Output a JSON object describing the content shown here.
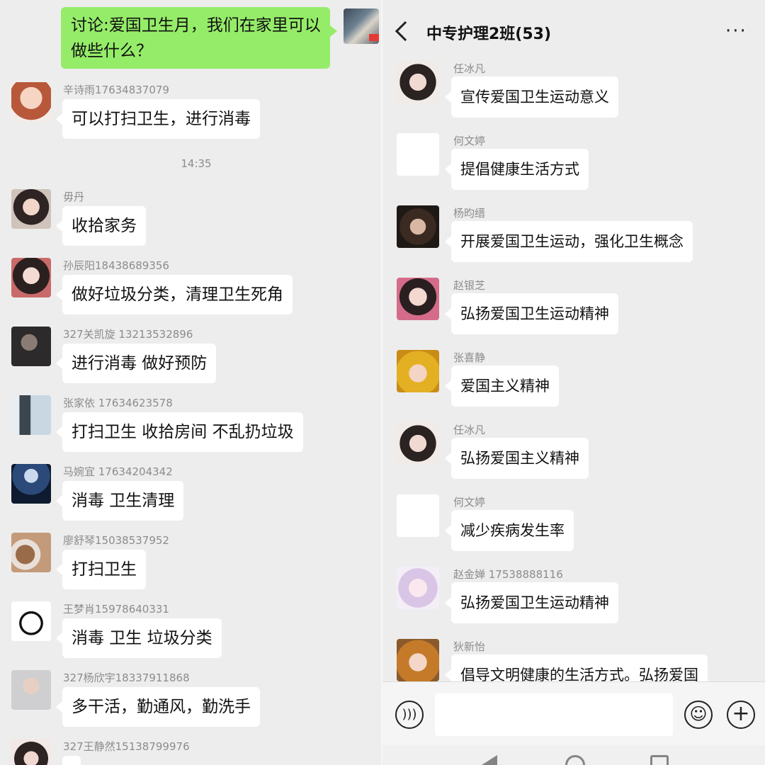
{
  "left": {
    "top_message": "讨论:爱国卫生月，我们在家里可以做些什么？",
    "timestamp": "14:35",
    "messages": [
      {
        "name": "辛诗雨17634837079",
        "text": "可以打扫卫生，进行消毒"
      },
      {
        "name": "毋丹",
        "text": "收拾家务"
      },
      {
        "name": "孙辰阳18438689356",
        "text": "做好垃圾分类，清理卫生死角"
      },
      {
        "name": "327关凯旋  13213532896",
        "text": "进行消毒  做好预防"
      },
      {
        "name": "张家依 17634623578",
        "text": "打扫卫生   收拾房间   不乱扔垃圾"
      },
      {
        "name": "马婉宜  17634204342",
        "text": "消毒   卫生清理"
      },
      {
        "name": "廖舒琴15038537952",
        "text": "打扫卫生"
      },
      {
        "name": "王梦肖15978640331",
        "text": "消毒 卫生 垃圾分类"
      },
      {
        "name": "327杨欣宇18337911868",
        "text": "多干活，勤通风，勤洗手"
      },
      {
        "name": "327王静然15138799976",
        "text": ""
      }
    ]
  },
  "right": {
    "header": {
      "title": "中专护理2班(53)",
      "more": "···"
    },
    "messages": [
      {
        "name": "任冰凡",
        "text": "宣传爱国卫生运动意义"
      },
      {
        "name": "何文婷",
        "text": "提倡健康生活方式"
      },
      {
        "name": "杨昀缙",
        "text": "开展爱国卫生运动，强化卫生概念"
      },
      {
        "name": "赵银芝",
        "text": "弘扬爱国卫生运动精神"
      },
      {
        "name": "张喜静",
        "text": "爱国主义精神"
      },
      {
        "name": "任冰凡",
        "text": "弘扬爱国主义精神"
      },
      {
        "name": "何文婷",
        "text": "减少疾病发生率"
      },
      {
        "name": "赵金婵    17538888116",
        "text": "弘扬爱国卫生运动精神"
      },
      {
        "name": "狄新怡",
        "text": "倡导文明健康的生活方式。弘扬爱国"
      }
    ],
    "input_bar": {
      "voice_icon": "voice-icon",
      "emoji_icon": "emoji-icon",
      "plus_icon": "plus-icon"
    }
  }
}
